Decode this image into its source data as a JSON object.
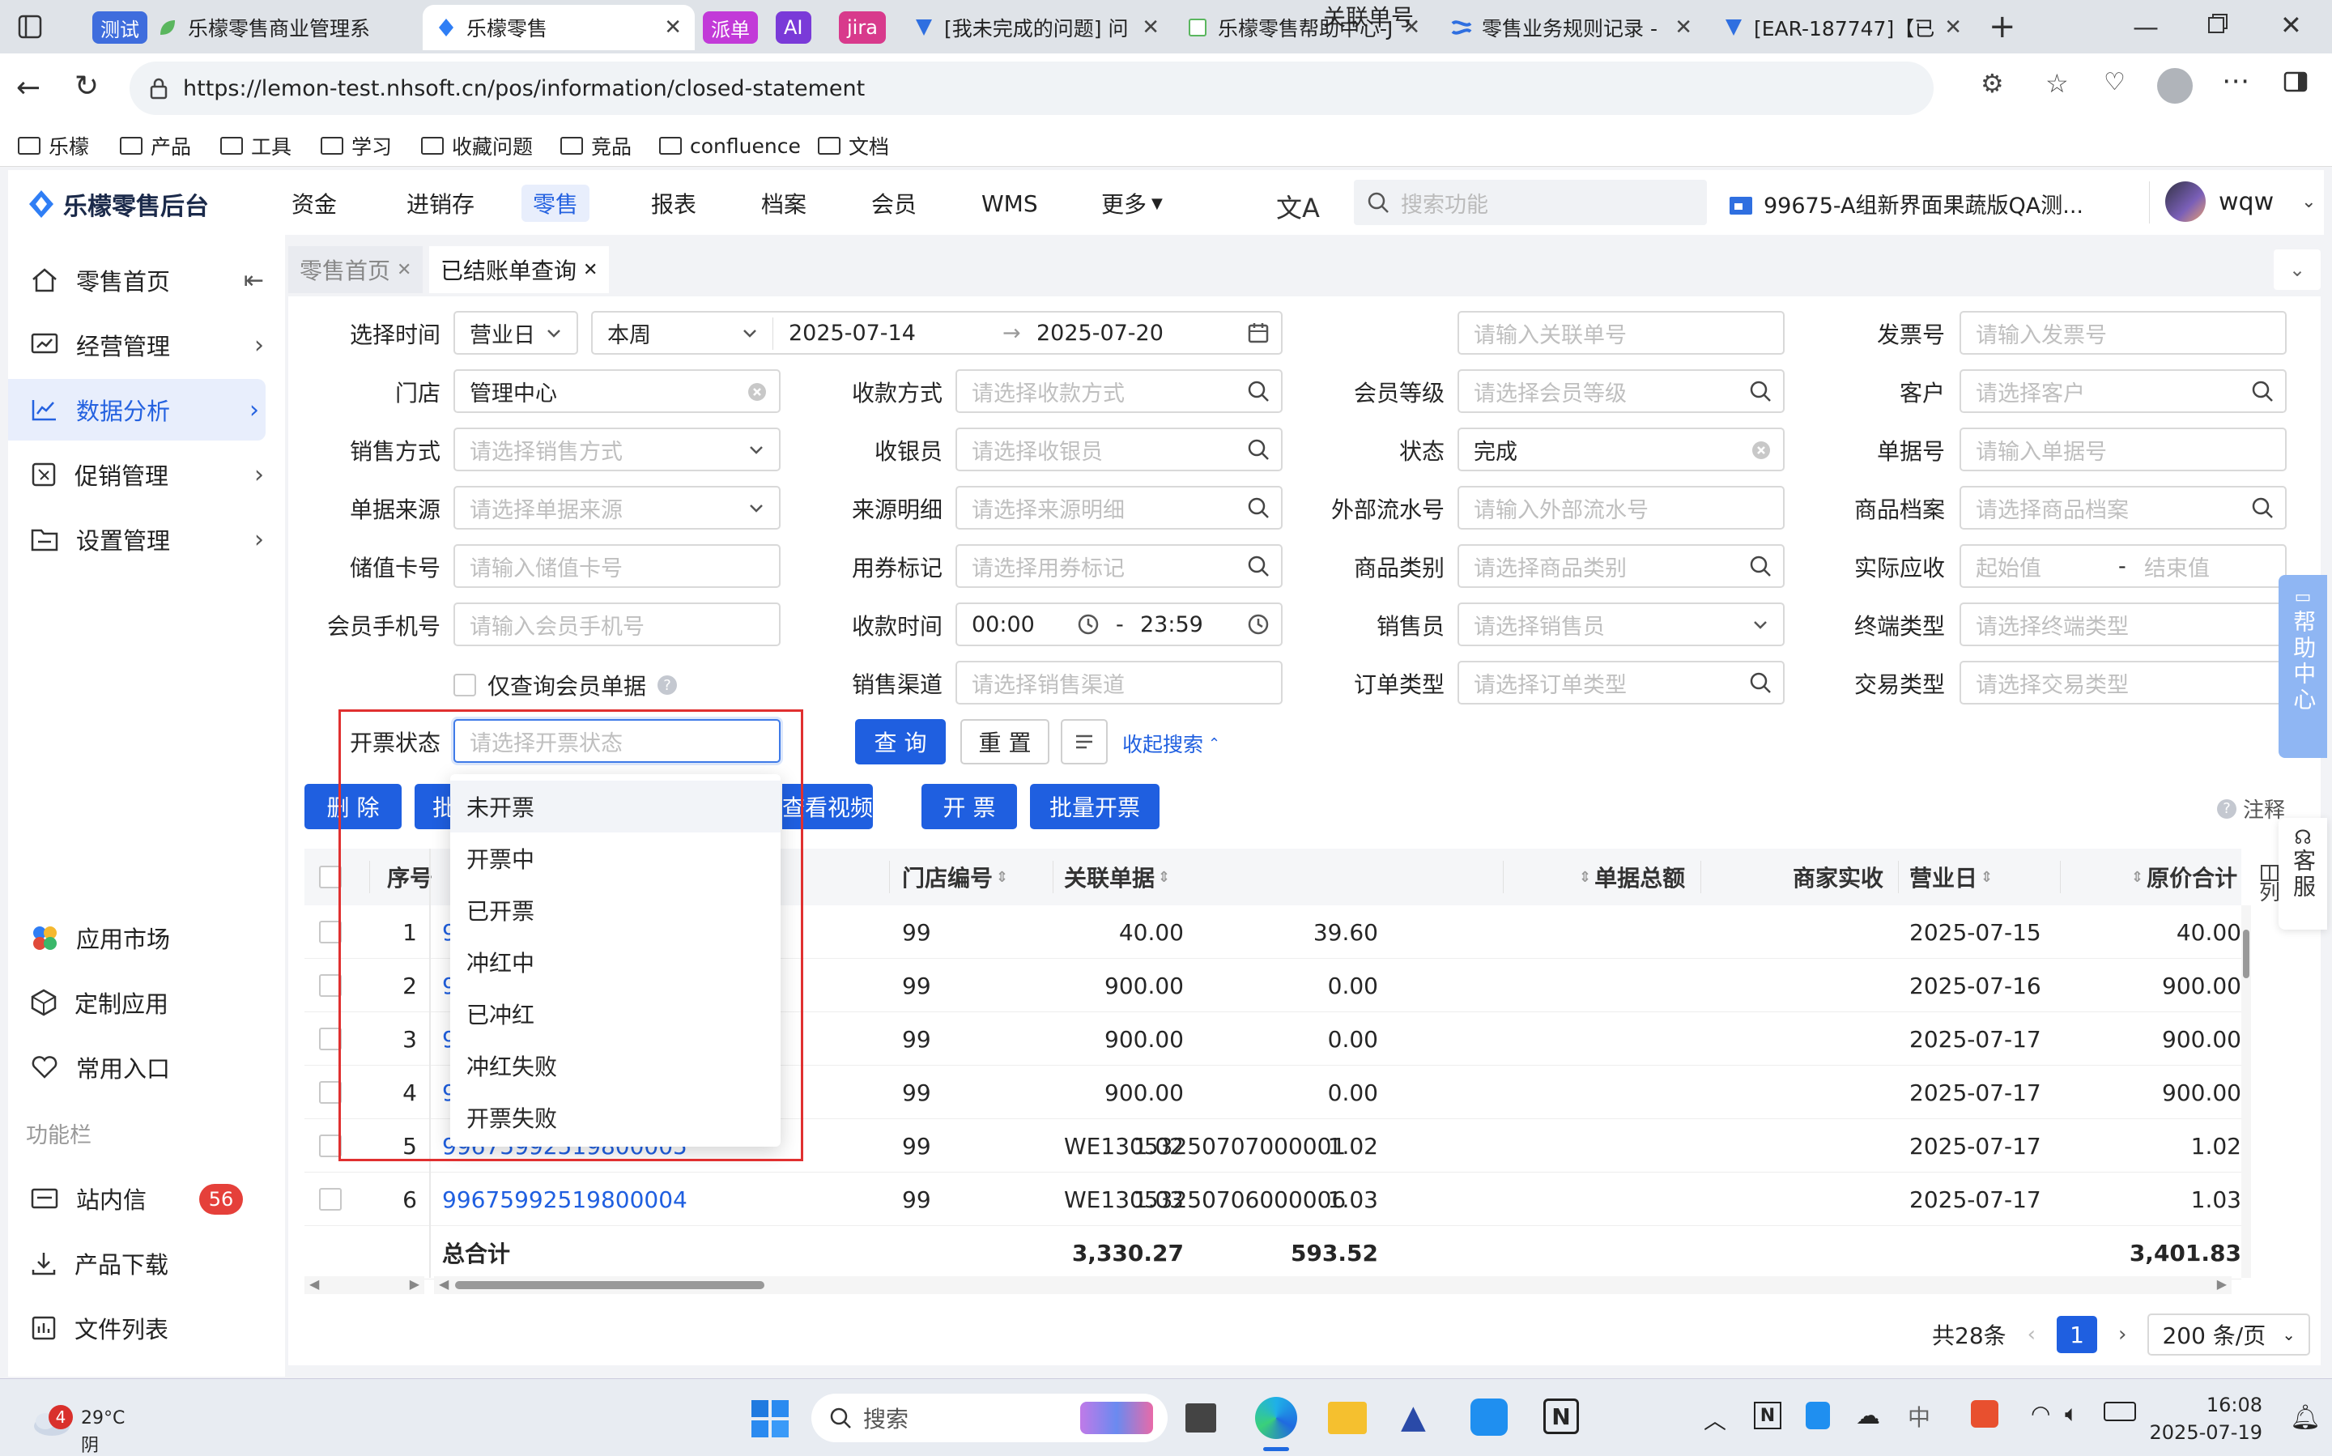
{
  "browser": {
    "tabs": [
      {
        "label": "乐檬零售商业管理系",
        "badge": "测试",
        "badge_color": "#3f6ddd"
      },
      {
        "label": "乐檬零售",
        "active": true
      },
      {
        "label": "派单",
        "badge_color": "#c23ad8"
      },
      {
        "label": "AI",
        "badge_color": "#7a3ad8"
      },
      {
        "label": "jira",
        "badge_color": "#d83a8c"
      },
      {
        "label": "[我未完成的问题] 问"
      },
      {
        "label": "乐檬零售帮助中心-J"
      },
      {
        "label": "零售业务规则记录 -"
      },
      {
        "label": "[EAR-187747]【已"
      }
    ],
    "url": "https://lemon-test.nhsoft.cn/pos/information/closed-statement",
    "bookmarks": [
      "乐檬",
      "产品",
      "工具",
      "学习",
      "收藏问题",
      "竞品",
      "confluence",
      "文档"
    ]
  },
  "app": {
    "brand": "乐檬零售后台",
    "nav": [
      "资金",
      "进销存",
      "零售",
      "报表",
      "档案",
      "会员",
      "WMS",
      "更多"
    ],
    "nav_selected": "零售",
    "search_placeholder": "搜索功能",
    "store": "99675-A组新界面果蔬版QA测...",
    "user": "wqw"
  },
  "sidebar": {
    "items": [
      {
        "label": "零售首页",
        "icon": "home-icon"
      },
      {
        "label": "经营管理",
        "icon": "chart-board-icon"
      },
      {
        "label": "数据分析",
        "icon": "line-chart-icon",
        "selected": true
      },
      {
        "label": "促销管理",
        "icon": "promotion-icon"
      },
      {
        "label": "设置管理",
        "icon": "settings-folder-icon"
      }
    ],
    "bottom": [
      {
        "label": "应用市场",
        "icon": "app-market-icon"
      },
      {
        "label": "定制应用",
        "icon": "custom-app-icon"
      },
      {
        "label": "常用入口",
        "icon": "heart-icon"
      }
    ],
    "section": "功能栏",
    "tools": [
      {
        "label": "站内信",
        "icon": "mail-icon",
        "count": "56"
      },
      {
        "label": "产品下载",
        "icon": "download-icon"
      },
      {
        "label": "文件列表",
        "icon": "file-list-icon"
      }
    ]
  },
  "page_tabs": [
    {
      "label": "零售首页",
      "active": false
    },
    {
      "label": "已结账单查询",
      "active": true
    }
  ],
  "filters": {
    "select_time": {
      "label": "选择时间",
      "type": "营业日",
      "range": "本周",
      "start": "2025-07-14",
      "end": "2025-07-20"
    },
    "related_no": {
      "label": "关联单号",
      "placeholder": "请输入关联单号"
    },
    "invoice_no": {
      "label": "发票号",
      "placeholder": "请输入发票号"
    },
    "store": {
      "label": "门店",
      "value": "管理中心"
    },
    "pay_method": {
      "label": "收款方式",
      "placeholder": "请选择收款方式"
    },
    "member_level": {
      "label": "会员等级",
      "placeholder": "请选择会员等级"
    },
    "customer": {
      "label": "客户",
      "placeholder": "请选择客户"
    },
    "sale_method": {
      "label": "销售方式",
      "placeholder": "请选择销售方式"
    },
    "cashier": {
      "label": "收银员",
      "placeholder": "请选择收银员"
    },
    "status": {
      "label": "状态",
      "value": "完成"
    },
    "doc_no": {
      "label": "单据号",
      "placeholder": "请输入单据号"
    },
    "doc_source": {
      "label": "单据来源",
      "placeholder": "请选择单据来源"
    },
    "source_detail": {
      "label": "来源明细",
      "placeholder": "请选择来源明细"
    },
    "ext_flow": {
      "label": "外部流水号",
      "placeholder": "请输入外部流水号"
    },
    "goods_archive": {
      "label": "商品档案",
      "placeholder": "请选择商品档案"
    },
    "card_no": {
      "label": "储值卡号",
      "placeholder": "请输入储值卡号"
    },
    "coupon_mark": {
      "label": "用券标记",
      "placeholder": "请选择用券标记"
    },
    "goods_cat": {
      "label": "商品类别",
      "placeholder": "请选择商品类别"
    },
    "actual_recv": {
      "label": "实际应收",
      "from": "起始值",
      "sep": "-",
      "to": "结束值"
    },
    "member_phone": {
      "label": "会员手机号",
      "placeholder": "请输入会员手机号"
    },
    "pay_time": {
      "label": "收款时间",
      "start": "00:00",
      "sep": "-",
      "end": "23:59"
    },
    "salesman": {
      "label": "销售员",
      "placeholder": "请选择销售员"
    },
    "terminal": {
      "label": "终端类型",
      "placeholder": "请选择终端类型"
    },
    "member_only": {
      "label": "仅查询会员单据"
    },
    "channel": {
      "label": "销售渠道",
      "placeholder": "请选择销售渠道"
    },
    "order_type": {
      "label": "订单类型",
      "placeholder": "请选择订单类型"
    },
    "trade_type": {
      "label": "交易类型",
      "placeholder": "请选择交易类型"
    },
    "invoice_status": {
      "label": "开票状态",
      "placeholder": "请选择开票状态"
    }
  },
  "actions": {
    "query": "查 询",
    "reset": "重 置",
    "collapse": "收起搜索"
  },
  "toolbar": {
    "delete": "删 除",
    "batch_partial": "批",
    "view_video": "查看视频",
    "invoice": "开 票",
    "batch_invoice": "批量开票",
    "note": "注释"
  },
  "dropdown": {
    "options": [
      "未开票",
      "开票中",
      "已开票",
      "冲红中",
      "已冲红",
      "冲红失败",
      "开票失败"
    ],
    "hovered": "未开票"
  },
  "table": {
    "columns": [
      "序号",
      "单",
      "门店编号",
      "关联单据",
      "单据总额",
      "商家实收",
      "营业日",
      "原价合计"
    ],
    "column_settings": "列",
    "rows": [
      {
        "idx": "1",
        "doc": "9",
        "store": "99",
        "related": "",
        "total": "40.00",
        "recv": "39.60",
        "day": "2025-07-15",
        "orig": "40.00"
      },
      {
        "idx": "2",
        "doc": "9",
        "store": "99",
        "related": "",
        "total": "900.00",
        "recv": "0.00",
        "day": "2025-07-16",
        "orig": "900.00"
      },
      {
        "idx": "3",
        "doc": "9",
        "store": "99",
        "related": "",
        "total": "900.00",
        "recv": "0.00",
        "day": "2025-07-17",
        "orig": "900.00"
      },
      {
        "idx": "4",
        "doc": "9",
        "store": "99",
        "related": "",
        "total": "900.00",
        "recv": "0.00",
        "day": "2025-07-17",
        "orig": "900.00"
      },
      {
        "idx": "5",
        "doc": "99675992519800005",
        "store": "99",
        "related": "WE13053250707000001",
        "total": "1.02",
        "recv": "1.02",
        "day": "2025-07-17",
        "orig": "1.02"
      },
      {
        "idx": "6",
        "doc": "99675992519800004",
        "store": "99",
        "related": "WE13053250706000006",
        "total": "1.03",
        "recv": "1.03",
        "day": "2025-07-17",
        "orig": "1.03"
      }
    ],
    "summary": {
      "label": "总合计",
      "total": "3,330.27",
      "recv": "593.52",
      "orig": "3,401.83"
    }
  },
  "pagination": {
    "total": "共28条",
    "page": "1",
    "page_size": "200 条/页"
  },
  "float_help": {
    "help": "帮助中心",
    "service": "客服"
  },
  "taskbar": {
    "temp": "29°C",
    "weather": "阴",
    "weather_badge": "4",
    "search": "搜索",
    "time": "16:08",
    "date": "2025-07-19"
  }
}
